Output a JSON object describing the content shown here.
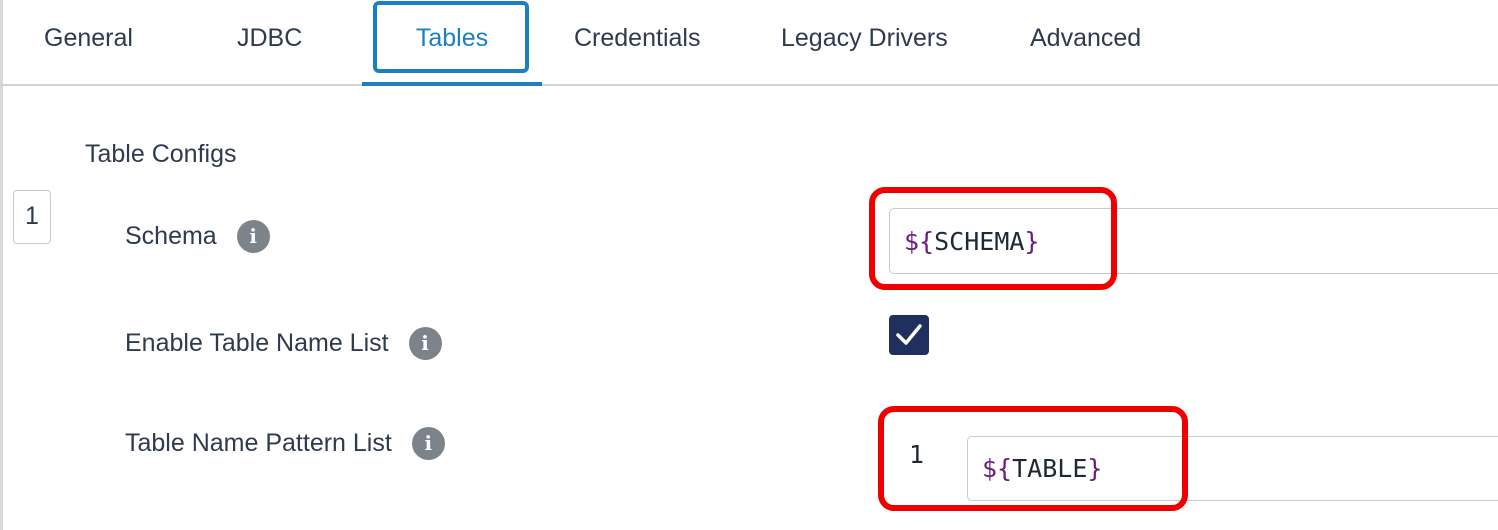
{
  "tabs": [
    {
      "label": "General",
      "active": false
    },
    {
      "label": "JDBC",
      "active": false
    },
    {
      "label": "Tables",
      "active": true
    },
    {
      "label": "Credentials",
      "active": false
    },
    {
      "label": "Legacy Drivers",
      "active": false
    },
    {
      "label": "Advanced",
      "active": false
    }
  ],
  "section": {
    "title": "Table Configs",
    "index": "1"
  },
  "fields": {
    "schema": {
      "label": "Schema",
      "value": "${SCHEMA}",
      "value_brace_open": "${",
      "value_name": "SCHEMA",
      "value_brace_close": "}"
    },
    "enable_table_name_list": {
      "label": "Enable Table Name List",
      "checked": true
    },
    "table_name_pattern_list": {
      "label": "Table Name Pattern List",
      "items": [
        {
          "index": "1",
          "value": "${TABLE}",
          "value_brace_open": "${",
          "value_name": "TABLE",
          "value_brace_close": "}"
        }
      ]
    }
  },
  "icons": {
    "info": "info-icon",
    "checkmark": "checkmark-icon"
  },
  "info_glyph": "i",
  "colors": {
    "accent": "#1c7fc2",
    "checkbox": "#1f2f5e",
    "highlight": "#ee0000",
    "variable_brace": "#6b1a7e",
    "info_icon": "#7c838b"
  }
}
